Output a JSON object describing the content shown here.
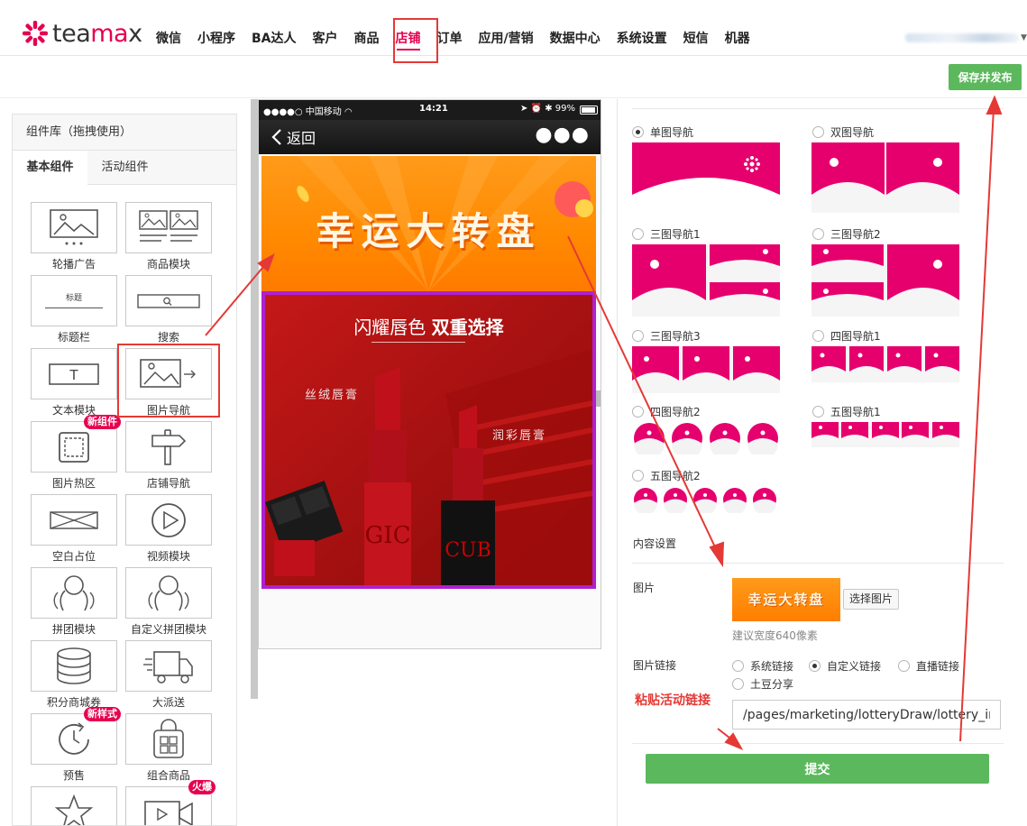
{
  "header": {
    "logo_text_pre": "tea",
    "logo_text_ma": "ma",
    "logo_text_post": "x",
    "nav": [
      "微信",
      "小程序",
      "BA达人",
      "客户",
      "商品",
      "店铺",
      "订单",
      "应用/营销",
      "数据中心",
      "系统设置",
      "短信",
      "机器"
    ],
    "active_nav": "店铺",
    "publish_label": "保存并发布"
  },
  "library": {
    "title": "组件库（拖拽使用）",
    "tabs": [
      "基本组件",
      "活动组件"
    ],
    "items": [
      {
        "label": "轮播广告",
        "icon": "carousel-icon"
      },
      {
        "label": "商品模块",
        "icon": "product-module-icon"
      },
      {
        "label": "标题栏",
        "icon": "title-bar-icon",
        "inner_text": "标题"
      },
      {
        "label": "搜索",
        "icon": "search-icon"
      },
      {
        "label": "文本模块",
        "icon": "text-module-icon"
      },
      {
        "label": "图片导航",
        "icon": "image-nav-icon"
      },
      {
        "label": "图片热区",
        "icon": "image-hotspot-icon",
        "badge": "新组件"
      },
      {
        "label": "店铺导航",
        "icon": "signpost-icon"
      },
      {
        "label": "空白占位",
        "icon": "blank-placeholder-icon"
      },
      {
        "label": "视频模块",
        "icon": "video-play-icon"
      },
      {
        "label": "拼团模块",
        "icon": "group-buy-icon"
      },
      {
        "label": "自定义拼团模块",
        "icon": "custom-group-buy-icon"
      },
      {
        "label": "积分商城券",
        "icon": "coin-stack-icon"
      },
      {
        "label": "大派送",
        "icon": "delivery-truck-icon"
      },
      {
        "label": "预售",
        "icon": "clock-icon",
        "badge": "新样式"
      },
      {
        "label": "组合商品",
        "icon": "shopping-bag-icon"
      },
      {
        "label": "",
        "icon": "star-icon"
      },
      {
        "label": "",
        "icon": "video-camera-icon",
        "badge": "火爆"
      }
    ]
  },
  "phone": {
    "carrier": "●●●●○ 中国移动 ",
    "time": "14:21",
    "battery": "99%",
    "back_label": "返回",
    "banner1_text": "幸运大转盘",
    "banner2_title_a": "闪耀唇色 ",
    "banner2_title_b": "双重选择",
    "banner2_tag1": "丝绒唇膏",
    "banner2_tag2": "润彩唇膏"
  },
  "settings": {
    "nav_options": [
      {
        "label": "单图导航",
        "selected": true
      },
      {
        "label": "双图导航",
        "selected": false
      },
      {
        "label": "三图导航1",
        "selected": false
      },
      {
        "label": "三图导航2",
        "selected": false
      },
      {
        "label": "三图导航3",
        "selected": false
      },
      {
        "label": "四图导航1",
        "selected": false
      },
      {
        "label": "四图导航2",
        "selected": false
      },
      {
        "label": "五图导航1",
        "selected": false
      },
      {
        "label": "五图导航2",
        "selected": false
      }
    ],
    "content_title": "内容设置",
    "image_label": "图片",
    "image_preview_text": "幸运大转盘",
    "choose_image": "选择图片",
    "width_hint": "建议宽度640像素",
    "link_label": "图片链接",
    "link_options": [
      {
        "label": "系统链接",
        "selected": false
      },
      {
        "label": "自定义链接",
        "selected": true
      },
      {
        "label": "直播链接",
        "selected": false
      },
      {
        "label": "土豆分享",
        "selected": false
      }
    ],
    "paste_note": "粘贴活动链接",
    "link_value": "/pages/marketing/lotteryDraw/lottery_index",
    "submit_label": "提交"
  },
  "colors": {
    "brand": "#e6004f",
    "green_button": "#5cb85c",
    "annotation_red": "#e53935",
    "banner_orange": "#ff8a00"
  }
}
